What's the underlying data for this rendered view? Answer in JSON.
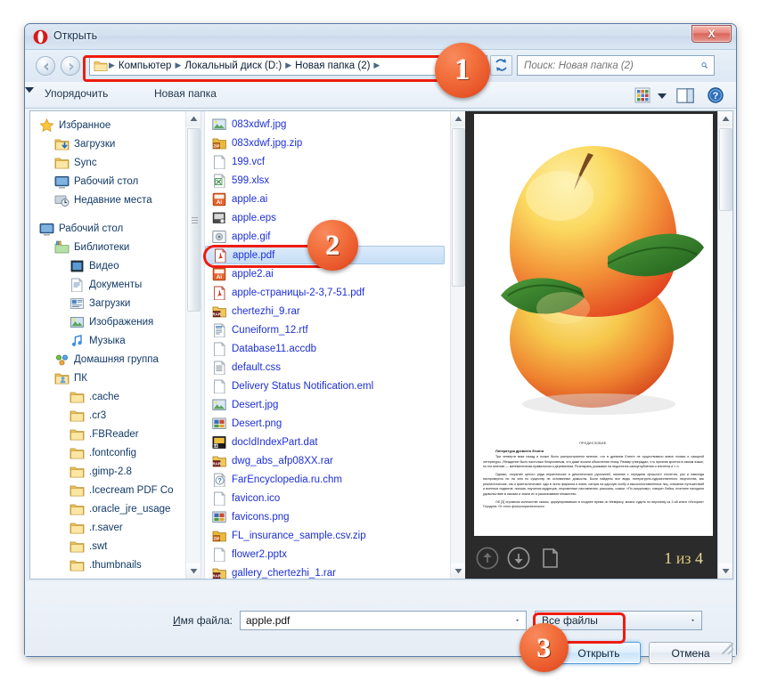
{
  "window": {
    "title": "Открыть",
    "close_label": "X",
    "app_icon": "opera-logo-icon"
  },
  "nav": {
    "back_icon": "back-arrow-icon",
    "forward_icon": "forward-arrow-icon",
    "breadcrumbs": [
      "Компьютер",
      "Локальный диск (D:)",
      "Новая папка (2)"
    ],
    "dropdown_icon": "chevron-down-icon",
    "refresh_icon": "refresh-icon"
  },
  "search": {
    "placeholder": "Поиск: Новая папка (2)",
    "value": "",
    "icon": "search-icon"
  },
  "toolbar": {
    "organize_label": "Упорядочить",
    "organize_caret": "▼",
    "new_folder_label": "Новая папка",
    "view_icon": "view-grid-icon",
    "view_caret": "▼",
    "pane_icon": "preview-pane-icon",
    "help_icon": "help-icon"
  },
  "sidebar": {
    "items": [
      {
        "label": "Избранное",
        "icon": "star-icon",
        "level": 0
      },
      {
        "label": "Загрузки",
        "icon": "downloads-folder-icon",
        "level": 1
      },
      {
        "label": "Sync",
        "icon": "folder-icon",
        "level": 1
      },
      {
        "label": "Рабочий стол",
        "icon": "desktop-icon",
        "level": 1
      },
      {
        "label": "Недавние места",
        "icon": "recent-places-icon",
        "level": 1
      },
      {
        "label": "",
        "icon": "gap",
        "level": -1
      },
      {
        "label": "Рабочий стол",
        "icon": "desktop-icon",
        "level": 0
      },
      {
        "label": "Библиотеки",
        "icon": "libraries-icon",
        "level": 1
      },
      {
        "label": "Видео",
        "icon": "video-library-icon",
        "level": 2
      },
      {
        "label": "Документы",
        "icon": "documents-library-icon",
        "level": 2
      },
      {
        "label": "Загрузки",
        "icon": "downloads-library-icon",
        "level": 2
      },
      {
        "label": "Изображения",
        "icon": "pictures-library-icon",
        "level": 2
      },
      {
        "label": "Музыка",
        "icon": "music-library-icon",
        "level": 2
      },
      {
        "label": "Домашняя группа",
        "icon": "homegroup-icon",
        "level": 1
      },
      {
        "label": "ПК",
        "icon": "user-folder-icon",
        "level": 1
      },
      {
        "label": ".cache",
        "icon": "folder-icon",
        "level": 2
      },
      {
        "label": ".cr3",
        "icon": "folder-icon",
        "level": 2
      },
      {
        "label": ".FBReader",
        "icon": "folder-icon",
        "level": 2
      },
      {
        "label": ".fontconfig",
        "icon": "folder-icon",
        "level": 2
      },
      {
        "label": ".gimp-2.8",
        "icon": "folder-icon",
        "level": 2
      },
      {
        "label": ".Icecream PDF Co",
        "icon": "folder-icon",
        "level": 2
      },
      {
        "label": ".oracle_jre_usage",
        "icon": "folder-icon",
        "level": 2
      },
      {
        "label": ".r.saver",
        "icon": "folder-icon",
        "level": 2
      },
      {
        "label": ".swt",
        "icon": "folder-icon",
        "level": 2
      },
      {
        "label": ".thumbnails",
        "icon": "folder-icon",
        "level": 2
      }
    ]
  },
  "files": {
    "selected": "apple.pdf",
    "items": [
      {
        "name": "083xdwf.jpg",
        "icon": "image-file-icon"
      },
      {
        "name": "083xdwf.jpg.zip",
        "icon": "zip-file-icon"
      },
      {
        "name": "199.vcf",
        "icon": "blank-file-icon"
      },
      {
        "name": "599.xlsx",
        "icon": "excel-file-icon"
      },
      {
        "name": "apple.ai",
        "icon": "illustrator-file-icon"
      },
      {
        "name": "apple.eps",
        "icon": "eps-file-icon"
      },
      {
        "name": "apple.gif",
        "icon": "gif-file-icon"
      },
      {
        "name": "apple.pdf",
        "icon": "pdf-file-icon"
      },
      {
        "name": "apple2.ai",
        "icon": "illustrator-file-icon"
      },
      {
        "name": "apple-страницы-2-3,7-51.pdf",
        "icon": "pdf-file-icon"
      },
      {
        "name": "chertezhi_9.rar",
        "icon": "rar-file-icon"
      },
      {
        "name": "Cuneiform_12.rtf",
        "icon": "rtf-file-icon"
      },
      {
        "name": "Database11.accdb",
        "icon": "blank-file-icon"
      },
      {
        "name": "default.css",
        "icon": "css-file-icon"
      },
      {
        "name": "Delivery Status Notification.eml",
        "icon": "blank-file-icon"
      },
      {
        "name": "Desert.jpg",
        "icon": "image-file-icon"
      },
      {
        "name": "Desert.png",
        "icon": "png-file-icon"
      },
      {
        "name": "docIdIndexPart.dat",
        "icon": "dat-file-icon"
      },
      {
        "name": "dwg_abs_afp08XX.rar",
        "icon": "rar-file-icon"
      },
      {
        "name": "FarEncyclopedia.ru.chm",
        "icon": "chm-file-icon"
      },
      {
        "name": "favicon.ico",
        "icon": "blank-file-icon"
      },
      {
        "name": "favicons.png",
        "icon": "png-file-icon"
      },
      {
        "name": "FL_insurance_sample.csv.zip",
        "icon": "zip-file-icon"
      },
      {
        "name": "flower2.pptx",
        "icon": "blank-file-icon"
      },
      {
        "name": "gallery_chertezhi_1.rar",
        "icon": "rar-file-icon"
      }
    ]
  },
  "preview": {
    "page_indicator": "1 из 4",
    "page_current": "1",
    "page_of": "из",
    "page_total": "4",
    "prev_icon": "page-up-icon",
    "next_icon": "page-down-icon",
    "page_icon": "page-view-icon",
    "document": {
      "heading": "ПРЕДИСЛОВИЕ.",
      "subheading": "Литература древнего Египта",
      "paragraphs": [
        "Три четверти века назад и позже было распространено мнение, что в древнем Египте не существовало вовсе поэзии и изящной литературы. Убеждение было настолько безусловным, что даже искали объяснения этому. Размер утверждал, что причина кроется в самом языке, по его мнению — математически-правильном и деревянном. Розенкранц указывал на недостаток самоуглубления и эпитетах и т. п.",
        "Однако, открытие целого ряда иератических и демотических рукописей, начиная с середины прошлого столетия, раз и навсегда ниспровергло ни на чем по существу не основанные домыслы. Были найдены все виды литературно-художественного творчества, как реалистические, так и фантастические: оды в честь фараона и знати, сатиры на царскую особу и высокопоставленных лиц, описание путешествий и военных подвигов, письма, поучения мудрецов, откровенные наставления, рассказы, сказки. «По-narурному», говорит Лейка, египтяне находили удовольствие в сказках и знали их и рассказывали множество.",
        "Об [3] огромном количестве сказок, циркулировавших в позднее время по Мемфису, можно судить по верхнему из 2-ой книги «История» Геродота. От этого фольклористического"
      ]
    }
  },
  "bottom": {
    "filename_label_underlined": "И",
    "filename_label_rest": "мя файла:",
    "filename_value": "apple.pdf",
    "filename_caret": "▼",
    "filter_value": "Все файлы",
    "filter_caret": "▼",
    "open_label": "Открыть",
    "cancel_label": "Отмена"
  },
  "annotations": {
    "badges": [
      {
        "number": "1",
        "target": "address-bar"
      },
      {
        "number": "2",
        "target": "selected-file-apple-pdf"
      },
      {
        "number": "3",
        "target": "open-button"
      }
    ],
    "highlight_color": "#ee1c10"
  }
}
